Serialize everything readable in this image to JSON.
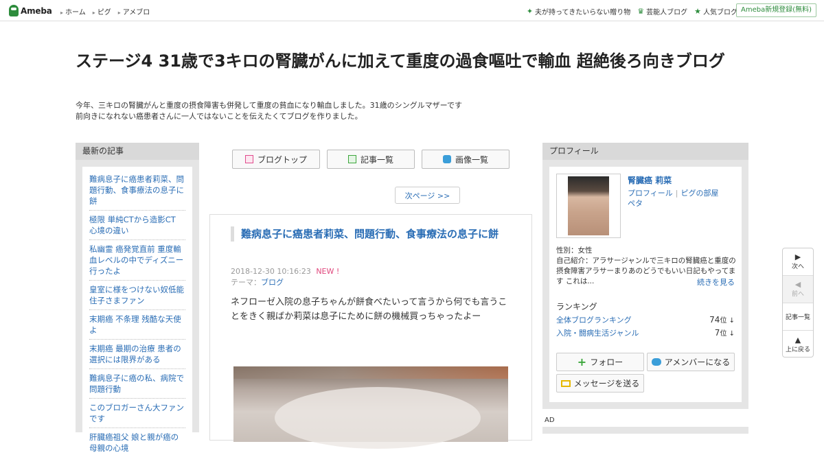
{
  "topbar": {
    "logo": "Ameba",
    "nav": [
      "ホーム",
      "ピグ",
      "アメブロ"
    ],
    "links": [
      {
        "icon": "sparkle-icon",
        "label": "夫が持ってきたいらない贈り物"
      },
      {
        "icon": "crown-icon",
        "label": "芸能人ブログ"
      },
      {
        "icon": "star-icon",
        "label": "人気ブログ"
      }
    ],
    "signup": "Ameba新規登録(無料)"
  },
  "header": {
    "title": "ステージ4 31歳で3キロの腎臓がんに加えて重度の過食嘔吐で輸血 超絶後ろ向きブログ",
    "description_line1": "今年、三キロの腎臓がんと重度の摂食障害も併発して重度の貧血になり輸血しました。31歳のシングルマザーです",
    "description_line2": "前向きになれない癌患者さんに一人ではないことを伝えたくてブログを作りました。"
  },
  "left": {
    "heading": "最新の記事",
    "items": [
      "難病息子に癌患者莉菜、問題行動、食事療法の息子に餅",
      "極限 単純CTから造影CT 心境の違い",
      "私幽霊 癌発覚直前 重度輸血レベルの中でディズニー行ったよ",
      "皇室に様をつけない奴低能 住子さまファン",
      "末期癌 不条理 残酷な天使よ",
      "末期癌 最期の治療 患者の選択には限界がある",
      "難病息子に癌の私、病院で問題行動",
      "このブロガーさん大ファンです",
      "肝臓癌祖父 娘と親が癌の母親の心境"
    ]
  },
  "center": {
    "tabs": [
      {
        "icon": "blog-top-icon",
        "label": "ブログトップ"
      },
      {
        "icon": "article-list-icon",
        "label": "記事一覧"
      },
      {
        "icon": "camera-icon",
        "label": "画像一覧"
      }
    ],
    "next_page": "次ページ >>",
    "article": {
      "title": "難病息子に癌患者莉菜、問題行動、食事療法の息子に餅",
      "date": "2018-12-30 10:16:23",
      "new_badge": "NEW !",
      "theme_label": "テーマ：",
      "theme": "ブログ",
      "body": "ネフローゼ入院の息子ちゃんが餅食べたいって言うから何でも言うことをきく親ばか莉菜は息子にために餅の機械買っちゃったよー"
    }
  },
  "right": {
    "heading": "プロフィール",
    "name": "腎臓癌 莉菜",
    "link_profile": "プロフィール",
    "link_room": "ピグの部屋",
    "link_peta": "ペタ",
    "gender": "性別：女性",
    "intro": "自己紹介：アラサージャンルで三キロの腎臓癌と重度の摂食障害アラサーまりあのどうでもいい日記もやってます これは...",
    "more": "続きを見る",
    "ranking_heading": "ランキング",
    "rankings": [
      {
        "label": "全体ブログランキング",
        "rank": "74",
        "unit": "位 ↓"
      },
      {
        "label": "入院・闘病生活ジャンル",
        "rank": "7",
        "unit": "位 ↓"
      }
    ],
    "follow": "フォロー",
    "amember": "アメンバーになる",
    "message": "メッセージを送る",
    "ad": "AD"
  },
  "floater": {
    "next": "次へ",
    "prev": "前へ",
    "list": "記事一覧",
    "top": "上に戻る"
  },
  "colors": {
    "brand_green": "#2d8c3c",
    "link_blue": "#2a6db5",
    "new_pink": "#e0467c"
  }
}
